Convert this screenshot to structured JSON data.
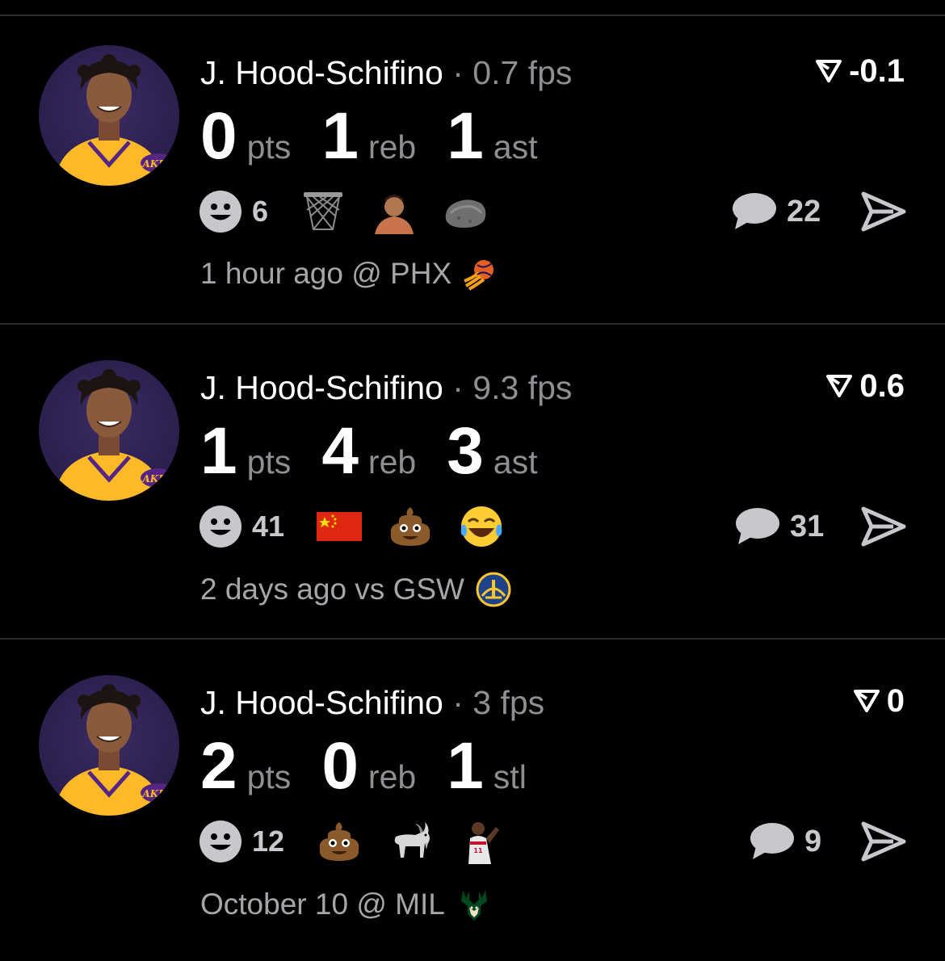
{
  "feed": {
    "posts": [
      {
        "player_name": "J. Hood-Schifino",
        "separator": "·",
        "fps": "0.7 fps",
        "score": "-0.1",
        "stats": [
          {
            "value": "0",
            "label": "pts"
          },
          {
            "value": "1",
            "label": "reb"
          },
          {
            "value": "1",
            "label": "ast"
          }
        ],
        "reaction_count": "6",
        "reactions": [
          "basketball-hoop-icon",
          "person-photo-icon",
          "rock-emoji-icon"
        ],
        "comment_count": "22",
        "time": "1 hour ago @ PHX",
        "opponent_logo": "suns-logo-icon"
      },
      {
        "player_name": "J. Hood-Schifino",
        "separator": "·",
        "fps": "9.3 fps",
        "score": "0.6",
        "stats": [
          {
            "value": "1",
            "label": "pts"
          },
          {
            "value": "4",
            "label": "reb"
          },
          {
            "value": "3",
            "label": "ast"
          }
        ],
        "reaction_count": "41",
        "reactions": [
          "china-flag-icon",
          "poop-emoji-icon",
          "laughing-tears-emoji-icon"
        ],
        "comment_count": "31",
        "time": "2 days ago vs GSW",
        "opponent_logo": "warriors-logo-icon"
      },
      {
        "player_name": "J. Hood-Schifino",
        "separator": "·",
        "fps": "3 fps",
        "score": "0",
        "stats": [
          {
            "value": "2",
            "label": "pts"
          },
          {
            "value": "0",
            "label": "reb"
          },
          {
            "value": "1",
            "label": "stl"
          }
        ],
        "reaction_count": "12",
        "reactions": [
          "poop-emoji-icon",
          "goat-emoji-icon",
          "player-photo-icon"
        ],
        "comment_count": "9",
        "time": "October 10 @ MIL",
        "opponent_logo": "bucks-logo-icon"
      }
    ]
  },
  "colors": {
    "background": "#000000",
    "primary_text": "#ffffff",
    "secondary_text": "#8e8e93",
    "icon_gray": "#c7c7cc",
    "divider": "#2a2a2c",
    "lakers_gold": "#fdb927",
    "lakers_purple": "#552583"
  }
}
